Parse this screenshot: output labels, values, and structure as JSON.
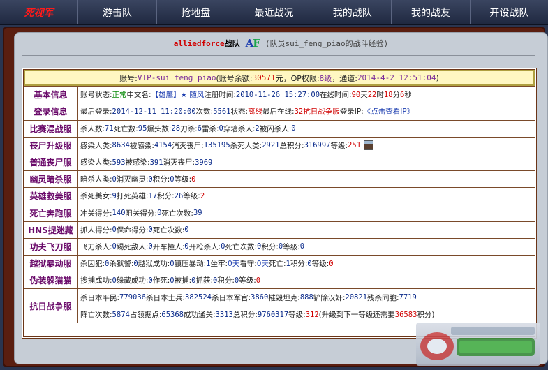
{
  "nav": {
    "brand": "死视军",
    "items": [
      "游击队",
      "抢地盘",
      "最近战况",
      "我的战队",
      "我的战友",
      "开设战队"
    ]
  },
  "header": {
    "team": "alliedforce",
    "team_suffix": "战队",
    "logo_a": "A",
    "logo_f": "F",
    "note": "(队员sui_feng_piao的战斗经验)"
  },
  "account": {
    "label1": "账号:",
    "account_id": "VIP-sui_feng_piao",
    "label2": "(账号余额:",
    "balance": "30571",
    "label3": "元，OP权限:",
    "op": "8级",
    "label4": "，通道:",
    "channel": "2014-4-2 12:51:04",
    "label5": ")"
  },
  "sections": [
    {
      "label": "基本信息",
      "parts": [
        {
          "t": "账号状态: "
        },
        {
          "g": "正常"
        },
        {
          "t": " 中文名: "
        },
        {
          "b": "【雄鹰】★ 随风"
        },
        {
          "t": " 注册时间: "
        },
        {
          "n": "2010-11-26 15:27:00"
        },
        {
          "t": " 在线时间: "
        },
        {
          "r": "90"
        },
        {
          "t": "天"
        },
        {
          "r": "22"
        },
        {
          "t": "时"
        },
        {
          "r": "18"
        },
        {
          "t": "分"
        },
        {
          "r": "6"
        },
        {
          "t": "秒"
        }
      ]
    },
    {
      "label": "登录信息",
      "parts": [
        {
          "t": "最后登录: "
        },
        {
          "n": "2014-12-11 11:20:00"
        },
        {
          "t": " 次数: "
        },
        {
          "n": "5561"
        },
        {
          "t": " 状态: "
        },
        {
          "r": "离线"
        },
        {
          "t": " 最后在线: "
        },
        {
          "r": "32抗日战争服"
        },
        {
          "t": " 登录IP: "
        },
        {
          "link": "《点击查看IP》"
        }
      ]
    },
    {
      "label": "比赛混战服",
      "parts": [
        {
          "t": "杀人数: "
        },
        {
          "n": "71"
        },
        {
          "t": " 死亡数: "
        },
        {
          "n": "95"
        },
        {
          "t": " 爆头数: "
        },
        {
          "n": "28"
        },
        {
          "t": " 刀杀: "
        },
        {
          "n": "6"
        },
        {
          "t": " 雷杀: "
        },
        {
          "n": "0"
        },
        {
          "t": " 穿墙杀人: "
        },
        {
          "n": "2"
        },
        {
          "t": " 被闪杀人: "
        },
        {
          "n": "0"
        }
      ]
    },
    {
      "label": "丧尸升级服",
      "avatar": true,
      "parts": [
        {
          "t": "感染人类: "
        },
        {
          "n": "8634"
        },
        {
          "t": " 被感染: "
        },
        {
          "n": "4154"
        },
        {
          "t": " 消灭丧尸: "
        },
        {
          "n": "135195"
        },
        {
          "t": " 杀死人类: "
        },
        {
          "n": "2921"
        },
        {
          "t": " 总积分: "
        },
        {
          "n": "316997"
        },
        {
          "t": " 等级: "
        },
        {
          "r": "251"
        }
      ]
    },
    {
      "label": "普通丧尸服",
      "parts": [
        {
          "t": "感染人类: "
        },
        {
          "n": "593"
        },
        {
          "t": " 被感染: "
        },
        {
          "n": "391"
        },
        {
          "t": " 消灭丧尸: "
        },
        {
          "n": "3969"
        }
      ]
    },
    {
      "label": "幽灵暗杀服",
      "parts": [
        {
          "t": "暗杀人类: "
        },
        {
          "n": "0"
        },
        {
          "t": " 消灭幽灵: "
        },
        {
          "n": "0"
        },
        {
          "t": " 积分: "
        },
        {
          "n": "0"
        },
        {
          "t": " 等级: "
        },
        {
          "r": "0"
        }
      ]
    },
    {
      "label": "英雄救美服",
      "parts": [
        {
          "t": "杀死美女: "
        },
        {
          "n": "9"
        },
        {
          "t": " 打死英雄: "
        },
        {
          "n": "17"
        },
        {
          "t": " 积分: "
        },
        {
          "n": "26"
        },
        {
          "t": " 等级: "
        },
        {
          "r": "2"
        }
      ]
    },
    {
      "label": "死亡奔跑服",
      "parts": [
        {
          "t": "冲关得分: "
        },
        {
          "n": "140"
        },
        {
          "t": " 阻关得分: "
        },
        {
          "n": "0"
        },
        {
          "t": " 死亡次数: "
        },
        {
          "n": "39"
        }
      ]
    },
    {
      "label": "HNS捉迷藏",
      "parts": [
        {
          "t": "抓人得分: "
        },
        {
          "n": "0"
        },
        {
          "t": " 保命得分: "
        },
        {
          "n": "0"
        },
        {
          "t": " 死亡次数: "
        },
        {
          "n": "0"
        }
      ]
    },
    {
      "label": "功夫飞刀服",
      "parts": [
        {
          "t": "飞刀杀人: "
        },
        {
          "n": "0"
        },
        {
          "t": " 踢死敌人: "
        },
        {
          "n": "0"
        },
        {
          "t": " 开车撞人: "
        },
        {
          "n": "0"
        },
        {
          "t": " 开枪杀人: "
        },
        {
          "n": "0"
        },
        {
          "t": " 死亡次数: "
        },
        {
          "n": "0"
        },
        {
          "t": " 积分: "
        },
        {
          "n": "0"
        },
        {
          "t": " 等级: "
        },
        {
          "n": "0"
        }
      ]
    },
    {
      "label": "越狱暴动服",
      "parts": [
        {
          "t": "杀囚犯: "
        },
        {
          "n": "0"
        },
        {
          "t": " 杀狱警: "
        },
        {
          "n": "0"
        },
        {
          "t": " 越狱成功: "
        },
        {
          "n": "0"
        },
        {
          "t": " 镇压暴动: "
        },
        {
          "n": "1"
        },
        {
          "t": " 坐牢: "
        },
        {
          "b": "0天"
        },
        {
          "t": " 看守: "
        },
        {
          "b": "0天"
        },
        {
          "t": " 死亡: "
        },
        {
          "n": "1"
        },
        {
          "t": " 积分: "
        },
        {
          "n": "0"
        },
        {
          "t": " 等级: "
        },
        {
          "r": "0"
        }
      ]
    },
    {
      "label": "伪装躲猫猫",
      "parts": [
        {
          "t": "搜捕成功: "
        },
        {
          "n": "0"
        },
        {
          "t": " 躲藏成功: "
        },
        {
          "n": "0"
        },
        {
          "t": " 作死: "
        },
        {
          "n": "0"
        },
        {
          "t": " 被捕: "
        },
        {
          "n": "0"
        },
        {
          "t": " 抓获: "
        },
        {
          "n": "0"
        },
        {
          "t": " 积分: "
        },
        {
          "n": "0"
        },
        {
          "t": " 等级: "
        },
        {
          "r": "0"
        }
      ]
    }
  ],
  "last_section": {
    "label": "抗日战争服",
    "line1": [
      {
        "t": "杀日本平民: "
      },
      {
        "n": "779036"
      },
      {
        "t": " 杀日本士兵: "
      },
      {
        "n": "382524"
      },
      {
        "t": " 杀日本军官: "
      },
      {
        "n": "3860"
      },
      {
        "t": " 摧毁坦克: "
      },
      {
        "n": "888"
      },
      {
        "t": " 铲除汉奸: "
      },
      {
        "n": "20821"
      },
      {
        "t": " 残杀同胞: "
      },
      {
        "n": "7719"
      }
    ],
    "line2": [
      {
        "t": "阵亡次数: "
      },
      {
        "n": "5874"
      },
      {
        "t": " 占领据点: "
      },
      {
        "n": "65368"
      },
      {
        "t": " 成功通关: "
      },
      {
        "n": "3313"
      },
      {
        "t": " 总积分: "
      },
      {
        "n": "9760317"
      },
      {
        "t": " 等级: "
      },
      {
        "r": "312"
      },
      {
        "t": " (升级到下一等级还需要"
      },
      {
        "r": "36583"
      },
      {
        "t": "积分)"
      }
    ]
  },
  "colors": {
    "nav_bg": "#2a3550",
    "frame": "#5a1e10",
    "panel": "#c6cdd6",
    "label": "#6a0a6a",
    "number": "#0a2a8a",
    "highlight": "#d00000"
  }
}
